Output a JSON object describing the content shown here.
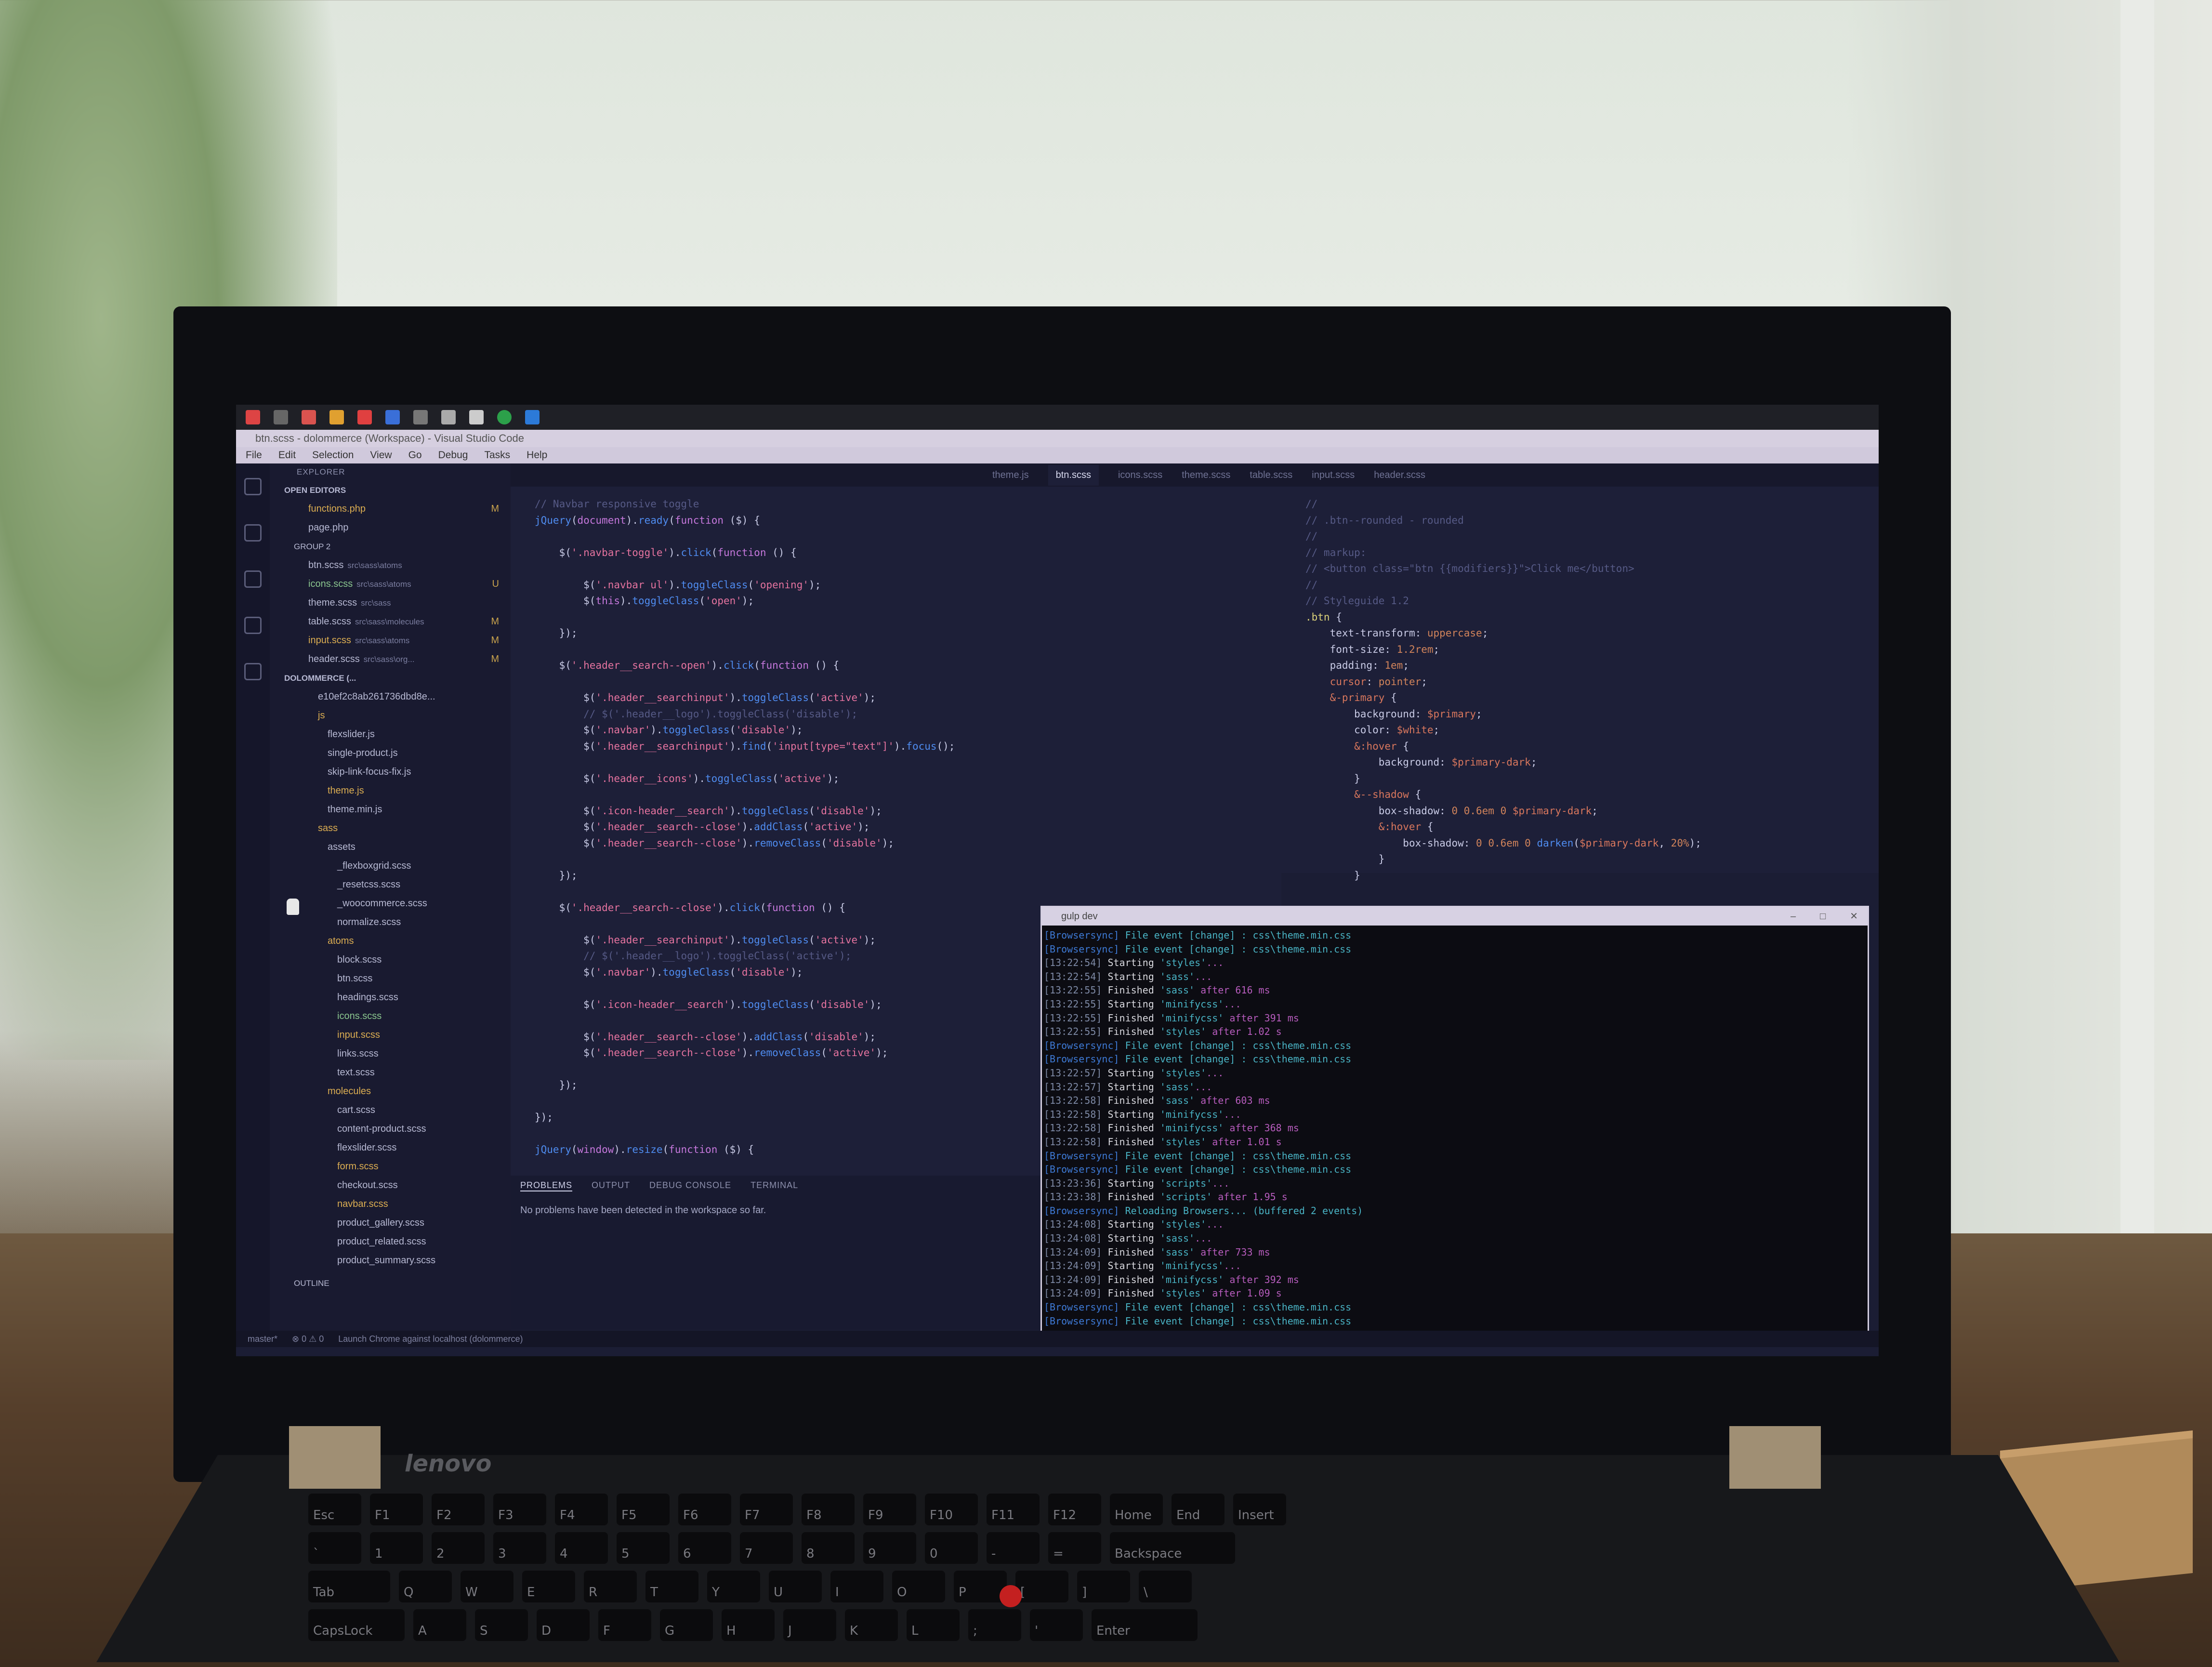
{
  "window": {
    "title": "btn.scss - dolommerce (Workspace) - Visual Studio Code",
    "menu": [
      "File",
      "Edit",
      "Selection",
      "View",
      "Go",
      "Debug",
      "Tasks",
      "Help"
    ]
  },
  "sidebar": {
    "header": "EXPLORER",
    "open_editors_label": "OPEN EDITORS",
    "group1": [
      {
        "name": "functions.php",
        "mod": "M"
      },
      {
        "name": "page.php",
        "mod": ""
      }
    ],
    "group2_label": "GROUP 2",
    "group2": [
      {
        "name": "btn.scss",
        "path": "src\\sass\\atoms",
        "mod": ""
      },
      {
        "name": "icons.scss",
        "path": "src\\sass\\atoms",
        "mod": "U"
      },
      {
        "name": "theme.scss",
        "path": "src\\sass",
        "mod": ""
      },
      {
        "name": "table.scss",
        "path": "src\\sass\\molecules",
        "mod": "M"
      },
      {
        "name": "input.scss",
        "path": "src\\sass\\atoms",
        "mod": "M"
      },
      {
        "name": "header.scss",
        "path": "src\\sass\\org...",
        "mod": "M"
      }
    ],
    "workspace_label": "DOLOMMERCE (...",
    "tree": [
      "e10ef2c8ab261736dbd8e...",
      "js",
      "flexslider.js",
      "single-product.js",
      "skip-link-focus-fix.js",
      "theme.js",
      "theme.min.js",
      "sass",
      "assets",
      "_flexboxgrid.scss",
      "_resetcss.scss",
      "_woocommerce.scss",
      "normalize.scss",
      "atoms",
      "block.scss",
      "btn.scss",
      "headings.scss",
      "icons.scss",
      "input.scss",
      "links.scss",
      "text.scss",
      "molecules",
      "cart.scss",
      "content-product.scss",
      "flexslider.scss",
      "form.scss",
      "checkout.scss",
      "navbar.scss",
      "product_gallery.scss",
      "product_related.scss",
      "product_summary.scss"
    ],
    "outline_label": "OUTLINE"
  },
  "tabs": [
    "theme.js",
    "btn.scss",
    "icons.scss",
    "theme.scss",
    "table.scss",
    "input.scss",
    "header.scss"
  ],
  "active_tab": "btn.scss",
  "panel": {
    "tabs": [
      "PROBLEMS",
      "OUTPUT",
      "DEBUG CONSOLE",
      "TERMINAL"
    ],
    "message": "No problems have been detected in the workspace so far."
  },
  "terminal": {
    "title": "gulp dev",
    "lines": [
      "[Browsersync] File event [change] : css\\theme.min.css",
      "[Browsersync] File event [change] : css\\theme.min.css",
      "[13:22:54] Starting 'styles'...",
      "[13:22:54] Starting 'sass'...",
      "[13:22:55] Finished 'sass' after 616 ms",
      "[13:22:55] Starting 'minifycss'...",
      "[13:22:55] Finished 'minifycss' after 391 ms",
      "[13:22:55] Finished 'styles' after 1.02 s",
      "[Browsersync] File event [change] : css\\theme.min.css",
      "[Browsersync] File event [change] : css\\theme.min.css",
      "[13:22:57] Starting 'styles'...",
      "[13:22:57] Starting 'sass'...",
      "[13:22:58] Finished 'sass' after 603 ms",
      "[13:22:58] Starting 'minifycss'...",
      "[13:22:58] Finished 'minifycss' after 368 ms",
      "[13:22:58] Finished 'styles' after 1.01 s",
      "[Browsersync] File event [change] : css\\theme.min.css",
      "[Browsersync] File event [change] : css\\theme.min.css",
      "[13:23:36] Starting 'scripts'...",
      "[13:23:38] Finished 'scripts' after 1.95 s",
      "[Browsersync] Reloading Browsers... (buffered 2 events)",
      "[13:24:08] Starting 'styles'...",
      "[13:24:08] Starting 'sass'...",
      "[13:24:09] Finished 'sass' after 733 ms",
      "[13:24:09] Starting 'minifycss'...",
      "[13:24:09] Finished 'minifycss' after 392 ms",
      "[13:24:09] Finished 'styles' after 1.09 s",
      "[Browsersync] File event [change] : css\\theme.min.css",
      "[Browsersync] File event [change] : css\\theme.min.css"
    ]
  },
  "status": {
    "branch": "master*",
    "problems": "⊗ 0 ⚠ 0",
    "launch": "Launch Chrome against localhost (dolommerce)"
  },
  "laptop_brand": "lenovo",
  "colors": {
    "accent": "#4f8cf0",
    "editor_bg": "#1d1f38",
    "terminal_bg": "#0c0c12"
  }
}
